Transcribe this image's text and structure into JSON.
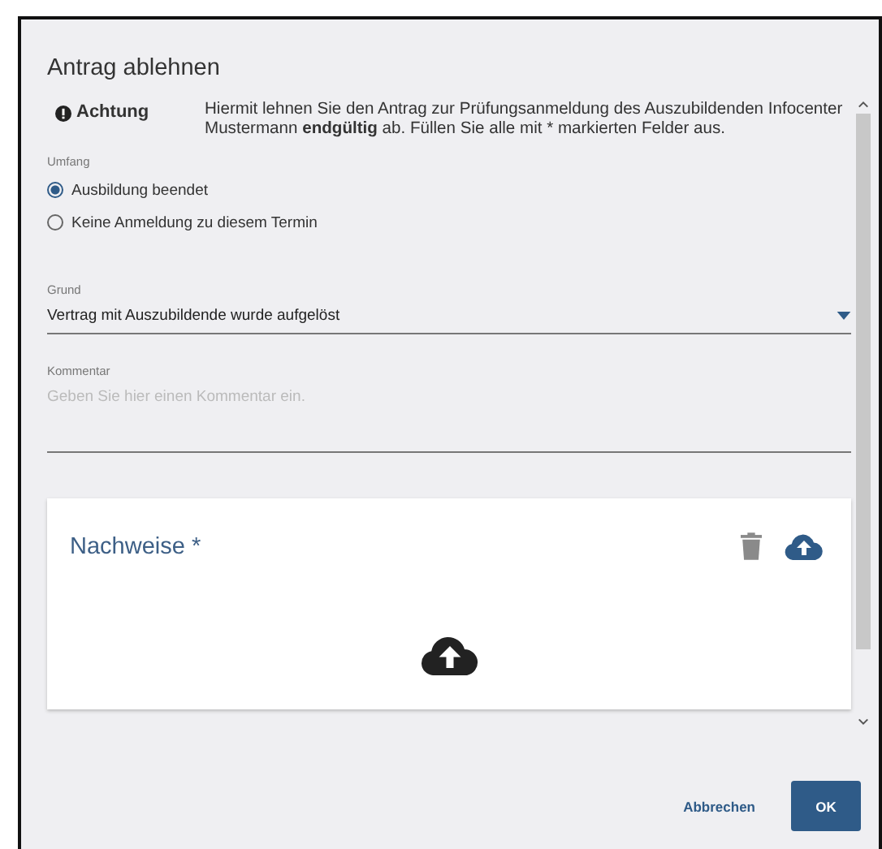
{
  "dialog": {
    "title": "Antrag ablehnen"
  },
  "notice": {
    "label": "Achtung",
    "text": "Hiermit lehnen Sie den Antrag zur Prüfungsanmeldung des Auszubildenden Infocenter Mustermann **endgültig** ab. Füllen Sie alle mit * markierten Felder aus."
  },
  "scope": {
    "label": "Umfang",
    "options": [
      {
        "label": "Ausbildung beendet",
        "selected": true
      },
      {
        "label": "Keine Anmeldung zu diesem Termin",
        "selected": false
      }
    ]
  },
  "reason": {
    "label": "Grund",
    "value": "Vertrag mit Auszubildende wurde aufgelöst"
  },
  "comment": {
    "label": "Kommentar",
    "placeholder": "Geben Sie hier einen Kommentar ein."
  },
  "attachments": {
    "title": "Nachweise *"
  },
  "buttons": [
    {
      "label": "Abbrechen",
      "kind": "text"
    },
    {
      "label": "OK",
      "kind": "primary"
    }
  ]
}
